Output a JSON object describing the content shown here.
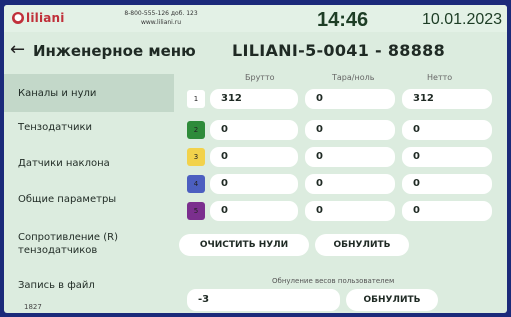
{
  "status_bar": {
    "logo_text": "liliani",
    "phone": "8-800-555-126 доб. 123",
    "website": "www.liliani.ru",
    "time": "14:46",
    "date": "10.01.2023"
  },
  "header": {
    "title": "Инженерное меню",
    "device_id": "LILIANI-5-0041 - 88888"
  },
  "sidebar": {
    "items": [
      {
        "label": "Каналы и нули",
        "active": true
      },
      {
        "label": "Тензодатчики",
        "active": false
      },
      {
        "label": "Датчики наклона",
        "active": false
      },
      {
        "label": "Общие параметры",
        "active": false
      },
      {
        "label": "Сопротивление (R) тензодатчиков",
        "active": false
      },
      {
        "label": "Запись в файл",
        "active": false
      }
    ],
    "footer_number": "1827"
  },
  "table": {
    "columns": [
      "Брутто",
      "Тара/ноль",
      "Нетто"
    ],
    "rows": [
      {
        "index": "1",
        "color": "#ffffff",
        "gross": "312",
        "tare": "0",
        "net": "312"
      },
      {
        "index": "2",
        "color": "#2e8b3a",
        "gross": "0",
        "tare": "0",
        "net": "0"
      },
      {
        "index": "3",
        "color": "#f2d24b",
        "gross": "0",
        "tare": "0",
        "net": "0"
      },
      {
        "index": "4",
        "color": "#4c5fc0",
        "gross": "0",
        "tare": "0",
        "net": "0"
      },
      {
        "index": "5",
        "color": "#7b2f8e",
        "gross": "0",
        "tare": "0",
        "net": "0"
      }
    ]
  },
  "actions": {
    "clear_zeros": "ОЧИСТИТЬ НУЛИ",
    "reset": "ОБНУЛИТЬ"
  },
  "user_zero": {
    "label": "Обнуление весов пользователем",
    "value": "-3",
    "reset": "ОБНУЛИТЬ"
  }
}
